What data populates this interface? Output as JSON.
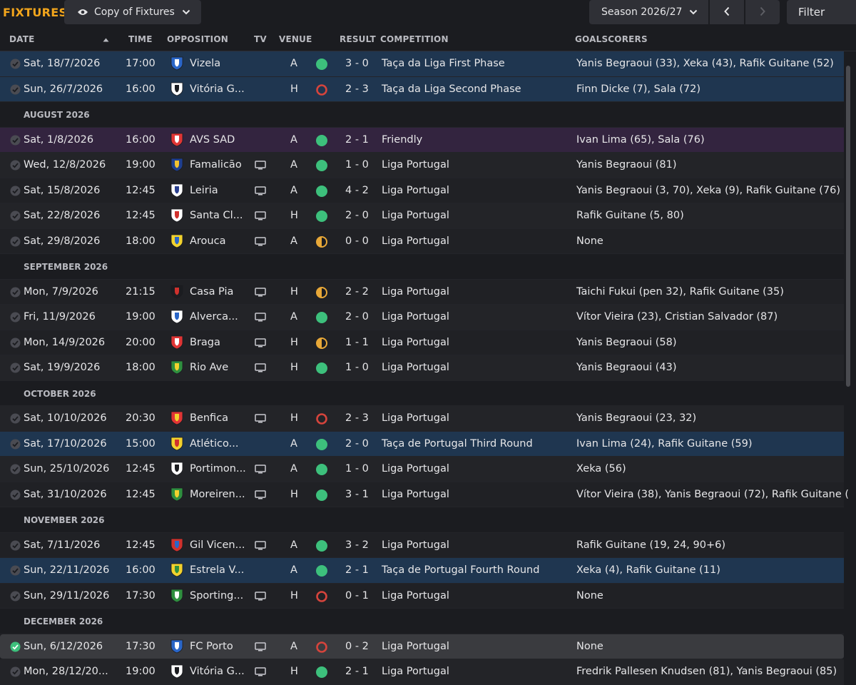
{
  "header": {
    "title": "FIXTURES",
    "view_label": "Copy of Fixtures",
    "season_label": "Season 2026/27",
    "filter_label": "Filter"
  },
  "columns": {
    "date": "DATE",
    "time": "TIME",
    "opposition": "OPPOSITION",
    "tv": "TV",
    "venue": "VENUE",
    "result": "RESULT",
    "competition": "COMPETITION",
    "goalscorers": "GOALSCORERS"
  },
  "colors": {
    "accent": "#f2a51c",
    "win": "#3dc07c",
    "draw": "#e8a838",
    "loss": "#d5443c",
    "cup_row": "#1f3650",
    "friendly_row": "#33243f"
  },
  "rows": [
    {
      "type": "match",
      "style": "cup",
      "date": "Sat, 18/7/2026",
      "time": "17:00",
      "badge": "vizela-badge",
      "opposition": "Vizela",
      "tv": false,
      "venue": "A",
      "outcome": "win",
      "score": "3 - 0",
      "competition": "Taça da Liga First Phase",
      "scorers": "Yanis Begraoui (33), Xeka (43), Rafik Guitane (52)"
    },
    {
      "type": "match",
      "style": "cup",
      "date": "Sun, 26/7/2026",
      "time": "16:00",
      "badge": "vitoria-badge",
      "opposition": "Vitória G...",
      "tv": false,
      "venue": "H",
      "outcome": "loss",
      "score": "2 - 3",
      "competition": "Taça da Liga Second Phase",
      "scorers": "Finn Dicke (7), Sala (72)"
    },
    {
      "type": "month",
      "label": "AUGUST 2026"
    },
    {
      "type": "match",
      "style": "friendly",
      "date": "Sat, 1/8/2026",
      "time": "16:00",
      "badge": "avs-badge",
      "opposition": "AVS SAD",
      "tv": false,
      "venue": "A",
      "outcome": "win",
      "score": "2 - 1",
      "competition": "Friendly",
      "scorers": "Ivan Lima (65), Sala (76)"
    },
    {
      "type": "match",
      "style": "normal",
      "date": "Wed, 12/8/2026",
      "time": "19:00",
      "badge": "famalicao-badge",
      "opposition": "Famalicão",
      "tv": true,
      "venue": "A",
      "outcome": "win",
      "score": "1 - 0",
      "competition": "Liga Portugal",
      "scorers": "Yanis Begraoui (81)"
    },
    {
      "type": "match",
      "style": "normal",
      "date": "Sat, 15/8/2026",
      "time": "12:45",
      "badge": "leiria-badge",
      "opposition": "Leiria",
      "tv": true,
      "venue": "A",
      "outcome": "win",
      "score": "4 - 2",
      "competition": "Liga Portugal",
      "scorers": "Yanis Begraoui (3, 70), Xeka (9), Rafik Guitane (76)"
    },
    {
      "type": "match",
      "style": "normal",
      "date": "Sat, 22/8/2026",
      "time": "12:45",
      "badge": "santa-clara-badge",
      "opposition": "Santa Cl...",
      "tv": true,
      "venue": "H",
      "outcome": "win",
      "score": "2 - 0",
      "competition": "Liga Portugal",
      "scorers": "Rafik Guitane (5, 80)"
    },
    {
      "type": "match",
      "style": "normal",
      "date": "Sat, 29/8/2026",
      "time": "18:00",
      "badge": "arouca-badge",
      "opposition": "Arouca",
      "tv": true,
      "venue": "A",
      "outcome": "draw",
      "score": "0 - 0",
      "competition": "Liga Portugal",
      "scorers": "None"
    },
    {
      "type": "month",
      "label": "SEPTEMBER 2026"
    },
    {
      "type": "match",
      "style": "normal",
      "date": "Mon, 7/9/2026",
      "time": "21:15",
      "badge": "casa-pia-badge",
      "opposition": "Casa Pia",
      "tv": true,
      "venue": "H",
      "outcome": "draw",
      "score": "2 - 2",
      "competition": "Liga Portugal",
      "scorers": "Taichi Fukui (pen 32), Rafik Guitane (35)"
    },
    {
      "type": "match",
      "style": "normal",
      "date": "Fri, 11/9/2026",
      "time": "19:00",
      "badge": "alverca-badge",
      "opposition": "Alverca...",
      "tv": true,
      "venue": "A",
      "outcome": "win",
      "score": "2 - 0",
      "competition": "Liga Portugal",
      "scorers": "Vítor Vieira (23), Cristian Salvador (87)"
    },
    {
      "type": "match",
      "style": "normal",
      "date": "Mon, 14/9/2026",
      "time": "20:00",
      "badge": "braga-badge",
      "opposition": "Braga",
      "tv": true,
      "venue": "H",
      "outcome": "draw",
      "score": "1 - 1",
      "competition": "Liga Portugal",
      "scorers": "Yanis Begraoui (58)"
    },
    {
      "type": "match",
      "style": "normal",
      "date": "Sat, 19/9/2026",
      "time": "18:00",
      "badge": "rio-ave-badge",
      "opposition": "Rio Ave",
      "tv": true,
      "venue": "H",
      "outcome": "win",
      "score": "1 - 0",
      "competition": "Liga Portugal",
      "scorers": "Yanis Begraoui (43)"
    },
    {
      "type": "month",
      "label": "OCTOBER 2026"
    },
    {
      "type": "match",
      "style": "normal",
      "date": "Sat, 10/10/2026",
      "time": "20:30",
      "badge": "benfica-badge",
      "opposition": "Benfica",
      "tv": true,
      "venue": "H",
      "outcome": "loss",
      "score": "2 - 3",
      "competition": "Liga Portugal",
      "scorers": "Yanis Begraoui (23, 32)"
    },
    {
      "type": "match",
      "style": "cup",
      "date": "Sat, 17/10/2026",
      "time": "15:00",
      "badge": "atletico-badge",
      "opposition": "Atlético...",
      "tv": false,
      "venue": "A",
      "outcome": "win",
      "score": "2 - 0",
      "competition": "Taça de Portugal Third Round",
      "scorers": "Ivan Lima (24), Rafik Guitane (59)"
    },
    {
      "type": "match",
      "style": "normal",
      "date": "Sun, 25/10/2026",
      "time": "12:45",
      "badge": "portimonense-badge",
      "opposition": "Portimon...",
      "tv": true,
      "venue": "A",
      "outcome": "win",
      "score": "1 - 0",
      "competition": "Liga Portugal",
      "scorers": "Xeka (56)"
    },
    {
      "type": "match",
      "style": "normal",
      "date": "Sat, 31/10/2026",
      "time": "12:45",
      "badge": "moreirense-badge",
      "opposition": "Moreiren...",
      "tv": true,
      "venue": "H",
      "outcome": "win",
      "score": "3 - 1",
      "competition": "Liga Portugal",
      "scorers": "Vítor Vieira (38), Yanis Begraoui (72), Rafik Guitane ("
    },
    {
      "type": "month",
      "label": "NOVEMBER 2026"
    },
    {
      "type": "match",
      "style": "normal",
      "date": "Sat, 7/11/2026",
      "time": "12:45",
      "badge": "gil-vicente-badge",
      "opposition": "Gil Vicen...",
      "tv": true,
      "venue": "A",
      "outcome": "win",
      "score": "3 - 2",
      "competition": "Liga Portugal",
      "scorers": "Rafik Guitane (19, 24, 90+6)"
    },
    {
      "type": "match",
      "style": "cup",
      "date": "Sun, 22/11/2026",
      "time": "16:00",
      "badge": "estrela-badge",
      "opposition": "Estrela V...",
      "tv": false,
      "venue": "A",
      "outcome": "win",
      "score": "2 - 1",
      "competition": "Taça de Portugal Fourth Round",
      "scorers": "Xeka (4), Rafik Guitane (11)"
    },
    {
      "type": "match",
      "style": "normal",
      "date": "Sun, 29/11/2026",
      "time": "17:30",
      "badge": "sporting-badge",
      "opposition": "Sporting...",
      "tv": true,
      "venue": "H",
      "outcome": "loss",
      "score": "0 - 1",
      "competition": "Liga Portugal",
      "scorers": "None"
    },
    {
      "type": "month",
      "label": "DECEMBER 2026"
    },
    {
      "type": "match",
      "style": "selected",
      "date": "Sun, 6/12/2026",
      "time": "17:30",
      "badge": "fc-porto-badge",
      "opposition": "FC Porto",
      "tv": true,
      "venue": "A",
      "outcome": "loss",
      "score": "0 - 2",
      "competition": "Liga Portugal",
      "scorers": "None"
    },
    {
      "type": "match",
      "style": "normal",
      "date": "Mon, 28/12/20...",
      "time": "19:00",
      "badge": "vitoria-badge",
      "opposition": "Vitória G...",
      "tv": true,
      "venue": "H",
      "outcome": "win",
      "score": "2 - 1",
      "competition": "Liga Portugal",
      "scorers": "Fredrik Pallesen Knudsen (81), Yanis Begraoui (85)"
    }
  ]
}
